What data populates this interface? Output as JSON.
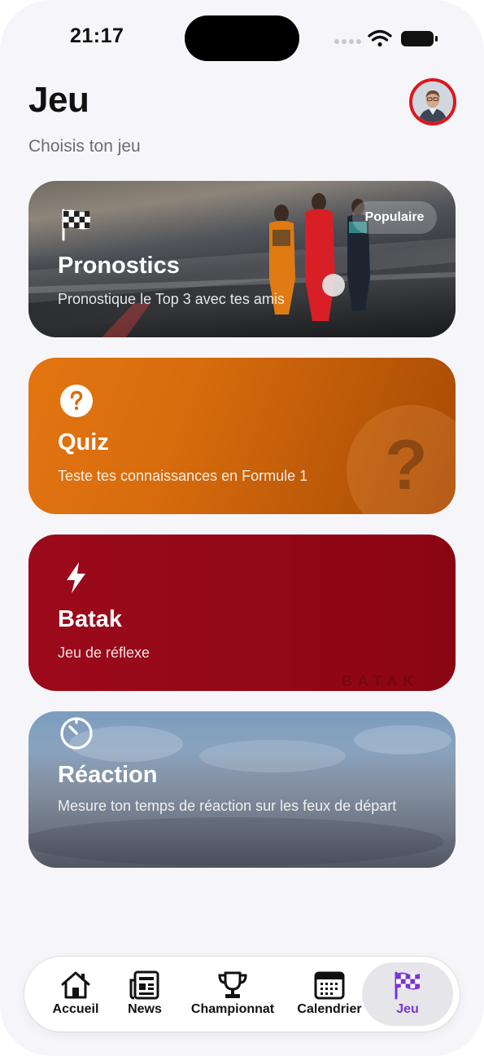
{
  "status_bar": {
    "time": "21:17"
  },
  "header": {
    "title": "Jeu",
    "subtitle": "Choisis ton jeu"
  },
  "cards": [
    {
      "title": "Pronostics",
      "description": "Pronostique le Top 3 avec tes amis",
      "badge": "Populaire",
      "icon": "checkered-flag-icon"
    },
    {
      "title": "Quiz",
      "description": "Teste tes connaissances en Formule 1",
      "icon": "question-circle-icon",
      "background_mark": "?"
    },
    {
      "title": "Batak",
      "description": "Jeu de réflexe",
      "icon": "lightning-icon",
      "watermark": "BATAK"
    },
    {
      "title": "Réaction",
      "description": "Mesure ton temps de réaction sur les feux de départ",
      "icon": "timer-icon"
    }
  ],
  "tabbar": {
    "items": [
      {
        "label": "Accueil",
        "icon": "home-icon"
      },
      {
        "label": "News",
        "icon": "newspaper-icon"
      },
      {
        "label": "Championnat",
        "icon": "trophy-icon"
      },
      {
        "label": "Calendrier",
        "icon": "calendar-icon"
      },
      {
        "label": "Jeu",
        "icon": "checkered-flag-icon",
        "active": true
      }
    ]
  },
  "colors": {
    "quiz": "#D86C0D",
    "batak": "#930716",
    "tab_active": "#7B33D8",
    "avatar_ring": "#E0141C"
  }
}
